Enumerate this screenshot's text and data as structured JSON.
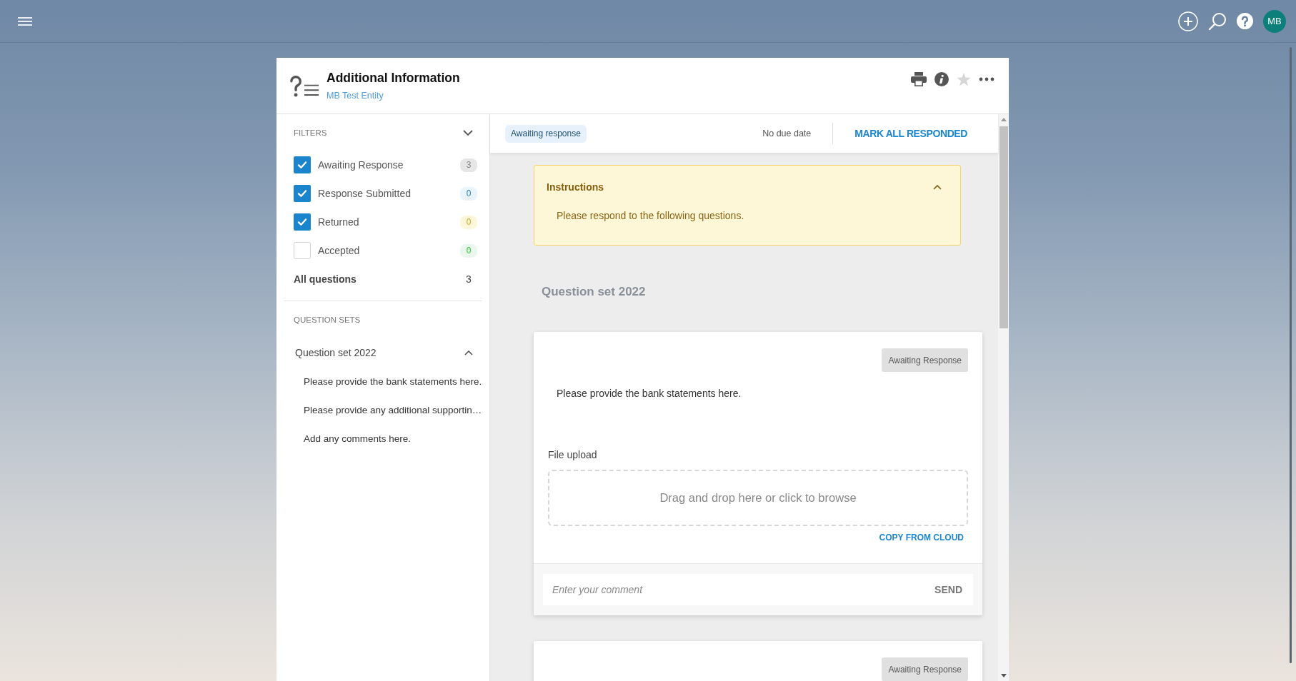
{
  "top_bar": {
    "avatar_initials": "MB"
  },
  "header": {
    "title": "Additional Information",
    "subtitle": "MB Test Entity",
    "starred": false
  },
  "sidebar": {
    "filters_title": "FILTERS",
    "filters": [
      {
        "label": "Awaiting Response",
        "checked": true,
        "count": "3",
        "color": "#e6e6e6"
      },
      {
        "label": "Response Submitted",
        "checked": true,
        "count": "0",
        "color": "#eaf4fc"
      },
      {
        "label": "Returned",
        "checked": true,
        "count": "0",
        "color": "#fdf6da"
      },
      {
        "label": "Accepted",
        "checked": false,
        "count": "0",
        "color": "#ebf6ec"
      }
    ],
    "total": {
      "label": "All questions",
      "count": "3"
    },
    "question_sets_title": "QUESTION SETS",
    "question_sets": [
      {
        "name": "Question set 2022",
        "expanded": true,
        "items": [
          "Please provide the bank statements here.",
          "Please provide any additional supportin…",
          "Add any comments here."
        ]
      }
    ]
  },
  "main": {
    "toolbar": {
      "status": "Awaiting response",
      "due": "No due date",
      "action": "MARK ALL RESPONDED"
    },
    "instructions": {
      "title": "Instructions",
      "expanded": true,
      "text": "Please respond to the following questions."
    },
    "question_set_heading": "Question set 2022",
    "questions": [
      {
        "status": "Awaiting Response",
        "text": "Please provide the bank statements here.",
        "upload_label": "File upload",
        "dropzone": "Drag and drop here or click to browse",
        "cloud_link": "COPY FROM CLOUD",
        "comment_placeholder": "Enter your comment",
        "send": "SEND"
      },
      {
        "status": "Awaiting Response"
      }
    ]
  }
}
